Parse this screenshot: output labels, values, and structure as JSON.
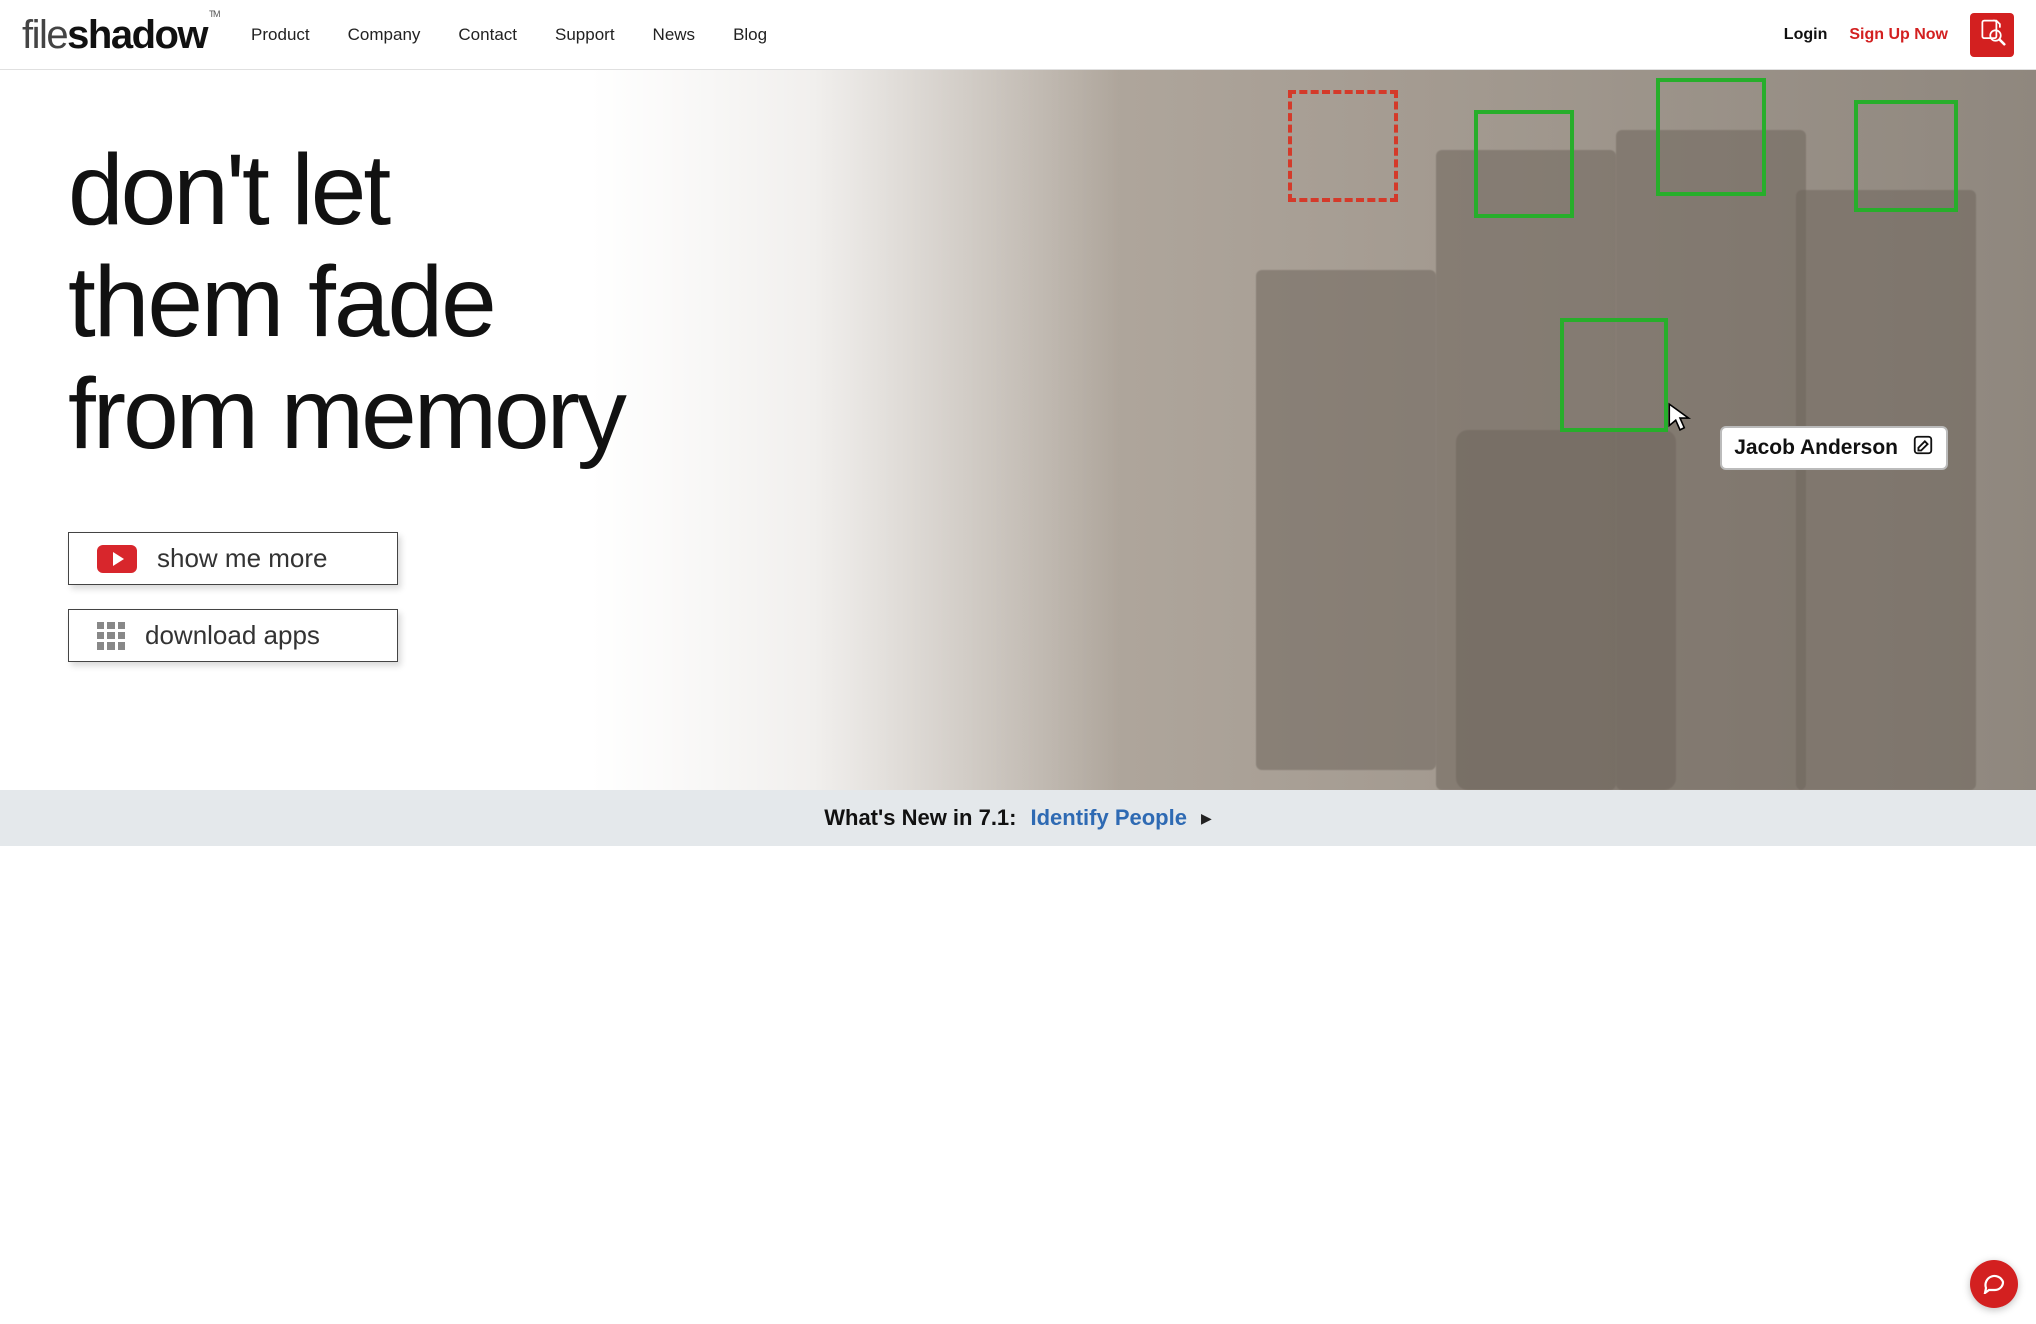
{
  "brand": {
    "part1": "file",
    "part2": "shadow",
    "tm": "TM"
  },
  "nav": {
    "items": [
      {
        "label": "Product"
      },
      {
        "label": "Company"
      },
      {
        "label": "Contact"
      },
      {
        "label": "Support"
      },
      {
        "label": "News"
      },
      {
        "label": "Blog"
      }
    ],
    "login": "Login",
    "signup": "Sign Up Now"
  },
  "hero": {
    "line1": "don't let",
    "line2": "them fade",
    "line3": "from memory",
    "cta_video": "show me more",
    "cta_apps": "download apps",
    "person_tag": "Jacob Anderson",
    "boxes": {
      "green_count": 4,
      "pending_count": 1,
      "green_color": "#27ae2b",
      "pending_color": "#d43a2a"
    }
  },
  "whatsnew": {
    "label": "What's New in 7.1:",
    "link": "Identify People"
  },
  "colors": {
    "brand_red": "#d32020",
    "link_blue": "#2e6ab3"
  }
}
